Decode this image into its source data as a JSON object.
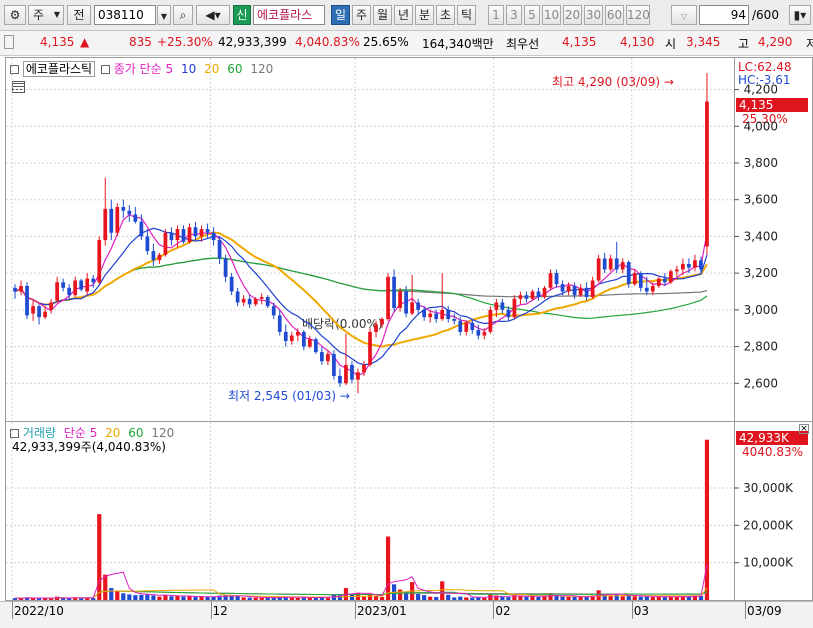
{
  "toolbar": {
    "market_label": "주",
    "period_label": "전",
    "stock_code": "038110",
    "new_label": "신",
    "stock_name": "에코플라스",
    "period_tabs": [
      "일",
      "주",
      "월",
      "년",
      "분",
      "초",
      "틱"
    ],
    "period_selected": "일",
    "minute_tabs": [
      "1",
      "3",
      "5",
      "10",
      "20",
      "30",
      "60",
      "120"
    ],
    "count_value": "94",
    "count_total": "/600"
  },
  "quote": {
    "price": "4,135",
    "arrow": "▲",
    "change": "835",
    "change_rate": "+25.30%",
    "volume": "42,933,399",
    "volume_rate": "4,040.83%",
    "turnover": "25.65%",
    "trade_value": "164,340백만",
    "top_bid_label": "최우선",
    "ask": "4,135",
    "bid": "4,130",
    "open_label": "시",
    "open": "3,345",
    "high_label": "고",
    "high": "4,290",
    "low_label": "저"
  },
  "price_panel": {
    "legend_name": "에코플라스틱",
    "legend_ma_label": "종가 단순",
    "ma_periods": [
      "5",
      "10",
      "20",
      "60",
      "120"
    ],
    "lc_label": "LC:62.48",
    "hc_label": "HC:-3.61",
    "current_price_label": "4,135",
    "current_rate_label": "25.30%",
    "high_annotation": "최고 4,290 (03/09)",
    "low_annotation": "최저 2,545 (01/03)",
    "dividend_annotation": "배당락(0.00%)"
  },
  "volume_panel": {
    "legend_name": "거래량",
    "legend_ma_label": "단순",
    "ma_periods": [
      "5",
      "20",
      "60",
      "120"
    ],
    "value_text": "42,933,399주(4,040.83%)",
    "current_volume_label": "42,933K",
    "current_rate_label": "4040.83%"
  },
  "colors": {
    "up": "#e8141e",
    "down": "#1f4bd3",
    "ma5": "#e020c0",
    "ma10": "#1f3fd0",
    "ma20": "#f0a800",
    "ma60": "#21a33a",
    "ma120": "#777777"
  },
  "chart_data": {
    "type": "candlestick",
    "price_axis": {
      "ylim": [
        2400,
        4350
      ],
      "ticks": [
        2600,
        2800,
        3000,
        3200,
        3400,
        3600,
        3800,
        4000,
        4200
      ]
    },
    "price_tick_labels": [
      "2,600",
      "2,800",
      "3,000",
      "3,200",
      "3,400",
      "3,600",
      "3,800",
      "4,000",
      "4,200"
    ],
    "volume_axis": {
      "ylim": [
        0,
        45000
      ],
      "ticks": [
        10000,
        20000,
        30000
      ]
    },
    "volume_tick_labels": [
      "10,000K",
      "20,000K",
      "30,000K"
    ],
    "x_labels": [
      {
        "label": "2022/10",
        "index": 0
      },
      {
        "label": "12",
        "index": 33
      },
      {
        "label": "2023/01",
        "index": 57
      },
      {
        "label": "02",
        "index": 80
      },
      {
        "label": "03",
        "index": 103
      },
      {
        "label": "03/09",
        "index": 121
      }
    ],
    "candles": [
      {
        "o": 3120,
        "h": 3140,
        "l": 3060,
        "c": 3100,
        "v": 500
      },
      {
        "o": 3100,
        "h": 3160,
        "l": 3080,
        "c": 3130,
        "v": 520
      },
      {
        "o": 3130,
        "h": 3150,
        "l": 2950,
        "c": 2970,
        "v": 680
      },
      {
        "o": 2980,
        "h": 3050,
        "l": 2940,
        "c": 3020,
        "v": 480
      },
      {
        "o": 3020,
        "h": 3030,
        "l": 2920,
        "c": 2960,
        "v": 560
      },
      {
        "o": 2960,
        "h": 3020,
        "l": 2950,
        "c": 2990,
        "v": 420
      },
      {
        "o": 3000,
        "h": 3060,
        "l": 2980,
        "c": 3040,
        "v": 450
      },
      {
        "o": 3050,
        "h": 3180,
        "l": 3040,
        "c": 3150,
        "v": 900
      },
      {
        "o": 3150,
        "h": 3170,
        "l": 3100,
        "c": 3120,
        "v": 500
      },
      {
        "o": 3120,
        "h": 3140,
        "l": 3060,
        "c": 3080,
        "v": 460
      },
      {
        "o": 3080,
        "h": 3180,
        "l": 3070,
        "c": 3160,
        "v": 620
      },
      {
        "o": 3160,
        "h": 3170,
        "l": 3100,
        "c": 3110,
        "v": 480
      },
      {
        "o": 3100,
        "h": 3200,
        "l": 3080,
        "c": 3170,
        "v": 700
      },
      {
        "o": 3170,
        "h": 3190,
        "l": 3120,
        "c": 3150,
        "v": 500
      },
      {
        "o": 3150,
        "h": 3400,
        "l": 3140,
        "c": 3380,
        "v": 23000
      },
      {
        "o": 3380,
        "h": 3720,
        "l": 3350,
        "c": 3550,
        "v": 6800
      },
      {
        "o": 3550,
        "h": 3600,
        "l": 3380,
        "c": 3420,
        "v": 3200
      },
      {
        "o": 3420,
        "h": 3580,
        "l": 3400,
        "c": 3560,
        "v": 2400
      },
      {
        "o": 3560,
        "h": 3600,
        "l": 3500,
        "c": 3540,
        "v": 1800
      },
      {
        "o": 3540,
        "h": 3570,
        "l": 3480,
        "c": 3520,
        "v": 1500
      },
      {
        "o": 3520,
        "h": 3560,
        "l": 3470,
        "c": 3480,
        "v": 1300
      },
      {
        "o": 3480,
        "h": 3520,
        "l": 3380,
        "c": 3400,
        "v": 1400
      },
      {
        "o": 3400,
        "h": 3440,
        "l": 3300,
        "c": 3320,
        "v": 1600
      },
      {
        "o": 3320,
        "h": 3360,
        "l": 3240,
        "c": 3270,
        "v": 1200
      },
      {
        "o": 3270,
        "h": 3310,
        "l": 3250,
        "c": 3300,
        "v": 900
      },
      {
        "o": 3300,
        "h": 3440,
        "l": 3290,
        "c": 3420,
        "v": 1400
      },
      {
        "o": 3420,
        "h": 3450,
        "l": 3350,
        "c": 3380,
        "v": 1000
      },
      {
        "o": 3380,
        "h": 3460,
        "l": 3340,
        "c": 3440,
        "v": 1100
      },
      {
        "o": 3440,
        "h": 3460,
        "l": 3360,
        "c": 3370,
        "v": 900
      },
      {
        "o": 3370,
        "h": 3470,
        "l": 3360,
        "c": 3450,
        "v": 1000
      },
      {
        "o": 3450,
        "h": 3480,
        "l": 3380,
        "c": 3400,
        "v": 850
      },
      {
        "o": 3400,
        "h": 3460,
        "l": 3370,
        "c": 3440,
        "v": 900
      },
      {
        "o": 3440,
        "h": 3470,
        "l": 3390,
        "c": 3420,
        "v": 800
      },
      {
        "o": 3420,
        "h": 3450,
        "l": 3350,
        "c": 3380,
        "v": 900
      },
      {
        "o": 3380,
        "h": 3400,
        "l": 3250,
        "c": 3280,
        "v": 1200
      },
      {
        "o": 3280,
        "h": 3300,
        "l": 3150,
        "c": 3180,
        "v": 1300
      },
      {
        "o": 3180,
        "h": 3200,
        "l": 3080,
        "c": 3100,
        "v": 1100
      },
      {
        "o": 3100,
        "h": 3120,
        "l": 3020,
        "c": 3040,
        "v": 1000
      },
      {
        "o": 3040,
        "h": 3080,
        "l": 3020,
        "c": 3060,
        "v": 700
      },
      {
        "o": 3060,
        "h": 3080,
        "l": 3010,
        "c": 3030,
        "v": 650
      },
      {
        "o": 3030,
        "h": 3070,
        "l": 3020,
        "c": 3060,
        "v": 600
      },
      {
        "o": 3060,
        "h": 3090,
        "l": 3030,
        "c": 3070,
        "v": 580
      },
      {
        "o": 3070,
        "h": 3080,
        "l": 3010,
        "c": 3020,
        "v": 620
      },
      {
        "o": 3020,
        "h": 3040,
        "l": 2950,
        "c": 2970,
        "v": 700
      },
      {
        "o": 2970,
        "h": 3000,
        "l": 2860,
        "c": 2880,
        "v": 900
      },
      {
        "o": 2880,
        "h": 2920,
        "l": 2800,
        "c": 2830,
        "v": 850
      },
      {
        "o": 2830,
        "h": 2880,
        "l": 2810,
        "c": 2860,
        "v": 600
      },
      {
        "o": 2860,
        "h": 2900,
        "l": 2830,
        "c": 2880,
        "v": 550
      },
      {
        "o": 2880,
        "h": 2890,
        "l": 2780,
        "c": 2800,
        "v": 800
      },
      {
        "o": 2800,
        "h": 2860,
        "l": 2790,
        "c": 2840,
        "v": 550
      },
      {
        "o": 2840,
        "h": 2850,
        "l": 2760,
        "c": 2770,
        "v": 700
      },
      {
        "o": 2770,
        "h": 2800,
        "l": 2700,
        "c": 2720,
        "v": 900
      },
      {
        "o": 2720,
        "h": 2780,
        "l": 2700,
        "c": 2760,
        "v": 600
      },
      {
        "o": 2760,
        "h": 2780,
        "l": 2620,
        "c": 2640,
        "v": 1500
      },
      {
        "o": 2640,
        "h": 2680,
        "l": 2580,
        "c": 2600,
        "v": 1300
      },
      {
        "o": 2600,
        "h": 2870,
        "l": 2590,
        "c": 2700,
        "v": 3200
      },
      {
        "o": 2700,
        "h": 2720,
        "l": 2600,
        "c": 2620,
        "v": 1600
      },
      {
        "o": 2620,
        "h": 2680,
        "l": 2545,
        "c": 2660,
        "v": 1800
      },
      {
        "o": 2660,
        "h": 2720,
        "l": 2640,
        "c": 2700,
        "v": 900
      },
      {
        "o": 2700,
        "h": 2900,
        "l": 2690,
        "c": 2880,
        "v": 1500
      },
      {
        "o": 2880,
        "h": 2940,
        "l": 2850,
        "c": 2920,
        "v": 1100
      },
      {
        "o": 2920,
        "h": 2960,
        "l": 2900,
        "c": 2950,
        "v": 800
      },
      {
        "o": 2950,
        "h": 3200,
        "l": 2940,
        "c": 3180,
        "v": 17000
      },
      {
        "o": 3180,
        "h": 3220,
        "l": 2990,
        "c": 3010,
        "v": 4200
      },
      {
        "o": 3010,
        "h": 3120,
        "l": 2990,
        "c": 3100,
        "v": 2800
      },
      {
        "o": 3100,
        "h": 3130,
        "l": 2960,
        "c": 2980,
        "v": 2300
      },
      {
        "o": 2980,
        "h": 3190,
        "l": 2970,
        "c": 3040,
        "v": 4800
      },
      {
        "o": 3040,
        "h": 3060,
        "l": 2980,
        "c": 3000,
        "v": 1600
      },
      {
        "o": 3000,
        "h": 3020,
        "l": 2940,
        "c": 2960,
        "v": 1300
      },
      {
        "o": 2960,
        "h": 3000,
        "l": 2930,
        "c": 2980,
        "v": 900
      },
      {
        "o": 2980,
        "h": 3000,
        "l": 2930,
        "c": 2950,
        "v": 800
      },
      {
        "o": 2950,
        "h": 3200,
        "l": 2940,
        "c": 3000,
        "v": 5000
      },
      {
        "o": 3000,
        "h": 3020,
        "l": 2930,
        "c": 2950,
        "v": 1400
      },
      {
        "o": 2950,
        "h": 2980,
        "l": 2920,
        "c": 2940,
        "v": 700
      },
      {
        "o": 2940,
        "h": 2960,
        "l": 2860,
        "c": 2880,
        "v": 900
      },
      {
        "o": 2880,
        "h": 2940,
        "l": 2860,
        "c": 2930,
        "v": 700
      },
      {
        "o": 2930,
        "h": 2950,
        "l": 2870,
        "c": 2890,
        "v": 650
      },
      {
        "o": 2890,
        "h": 2920,
        "l": 2840,
        "c": 2860,
        "v": 700
      },
      {
        "o": 2860,
        "h": 2900,
        "l": 2840,
        "c": 2880,
        "v": 600
      },
      {
        "o": 2880,
        "h": 3020,
        "l": 2870,
        "c": 3000,
        "v": 1400
      },
      {
        "o": 3000,
        "h": 3060,
        "l": 2960,
        "c": 3040,
        "v": 1200
      },
      {
        "o": 3040,
        "h": 3060,
        "l": 2980,
        "c": 3000,
        "v": 900
      },
      {
        "o": 3000,
        "h": 3020,
        "l": 2940,
        "c": 2960,
        "v": 800
      },
      {
        "o": 2960,
        "h": 3080,
        "l": 2950,
        "c": 3060,
        "v": 1300
      },
      {
        "o": 3060,
        "h": 3100,
        "l": 3030,
        "c": 3080,
        "v": 1100
      },
      {
        "o": 3080,
        "h": 3100,
        "l": 3040,
        "c": 3060,
        "v": 900
      },
      {
        "o": 3060,
        "h": 3110,
        "l": 3050,
        "c": 3100,
        "v": 1000
      },
      {
        "o": 3100,
        "h": 3120,
        "l": 3050,
        "c": 3070,
        "v": 800
      },
      {
        "o": 3070,
        "h": 3130,
        "l": 3060,
        "c": 3120,
        "v": 1100
      },
      {
        "o": 3120,
        "h": 3220,
        "l": 3110,
        "c": 3200,
        "v": 1800
      },
      {
        "o": 3200,
        "h": 3220,
        "l": 3120,
        "c": 3140,
        "v": 1200
      },
      {
        "o": 3140,
        "h": 3160,
        "l": 3080,
        "c": 3100,
        "v": 900
      },
      {
        "o": 3100,
        "h": 3150,
        "l": 3080,
        "c": 3130,
        "v": 800
      },
      {
        "o": 3130,
        "h": 3150,
        "l": 3060,
        "c": 3080,
        "v": 900
      },
      {
        "o": 3080,
        "h": 3140,
        "l": 3070,
        "c": 3120,
        "v": 800
      },
      {
        "o": 3120,
        "h": 3150,
        "l": 3050,
        "c": 3070,
        "v": 900
      },
      {
        "o": 3070,
        "h": 3180,
        "l": 3060,
        "c": 3160,
        "v": 1200
      },
      {
        "o": 3160,
        "h": 3300,
        "l": 3150,
        "c": 3280,
        "v": 2600
      },
      {
        "o": 3280,
        "h": 3310,
        "l": 3200,
        "c": 3220,
        "v": 1500
      },
      {
        "o": 3220,
        "h": 3300,
        "l": 3210,
        "c": 3280,
        "v": 1200
      },
      {
        "o": 3280,
        "h": 3370,
        "l": 3200,
        "c": 3220,
        "v": 1600
      },
      {
        "o": 3220,
        "h": 3280,
        "l": 3200,
        "c": 3260,
        "v": 1000
      },
      {
        "o": 3260,
        "h": 3270,
        "l": 3120,
        "c": 3140,
        "v": 1300
      },
      {
        "o": 3140,
        "h": 3220,
        "l": 3130,
        "c": 3200,
        "v": 1000
      },
      {
        "o": 3200,
        "h": 3210,
        "l": 3100,
        "c": 3120,
        "v": 900
      },
      {
        "o": 3120,
        "h": 3180,
        "l": 3080,
        "c": 3100,
        "v": 900
      },
      {
        "o": 3100,
        "h": 3150,
        "l": 3080,
        "c": 3130,
        "v": 800
      },
      {
        "o": 3130,
        "h": 3180,
        "l": 3120,
        "c": 3170,
        "v": 900
      },
      {
        "o": 3170,
        "h": 3200,
        "l": 3130,
        "c": 3150,
        "v": 800
      },
      {
        "o": 3150,
        "h": 3220,
        "l": 3140,
        "c": 3210,
        "v": 900
      },
      {
        "o": 3210,
        "h": 3240,
        "l": 3180,
        "c": 3220,
        "v": 800
      },
      {
        "o": 3220,
        "h": 3280,
        "l": 3190,
        "c": 3250,
        "v": 1100
      },
      {
        "o": 3250,
        "h": 3280,
        "l": 3200,
        "c": 3230,
        "v": 900
      },
      {
        "o": 3230,
        "h": 3300,
        "l": 3210,
        "c": 3270,
        "v": 1200
      },
      {
        "o": 3270,
        "h": 3290,
        "l": 3200,
        "c": 3220,
        "v": 1100
      },
      {
        "o": 3345,
        "h": 4290,
        "l": 3300,
        "c": 4135,
        "v": 42933
      }
    ]
  }
}
